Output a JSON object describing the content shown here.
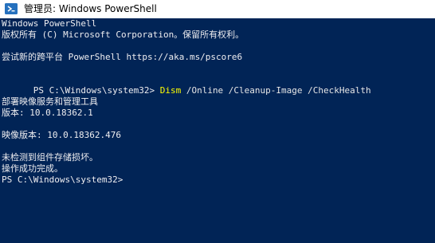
{
  "window": {
    "title": "管理员: Windows PowerShell",
    "icon": "powershell-icon"
  },
  "console": {
    "background": "#012456",
    "foreground": "#eeedf0",
    "command_color": "#ffff00",
    "lines": [
      "Windows PowerShell",
      "版权所有 (C) Microsoft Corporation。保留所有权利。",
      "",
      "尝试新的跨平台 PowerShell https://aka.ms/pscore6",
      "",
      "",
      "",
      "部署映像服务和管理工具",
      "版本: 10.0.18362.1",
      "",
      "映像版本: 10.0.18362.476",
      "",
      "未检测到组件存储损坏。",
      "操作成功完成。",
      "PS C:\\Windows\\system32>"
    ],
    "command_line": {
      "prompt": "PS C:\\Windows\\system32> ",
      "command": "Dism",
      "arguments": " /Online /Cleanup-Image /CheckHealth"
    }
  }
}
